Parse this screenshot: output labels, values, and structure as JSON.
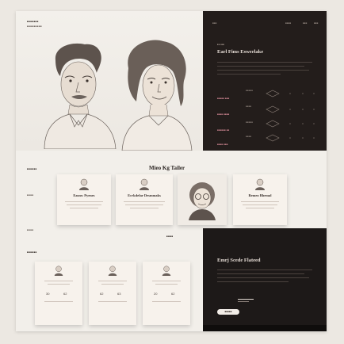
{
  "header": {
    "brand": "■■■■■■■",
    "brand_sub": "■■■■■■■■■"
  },
  "hero": {
    "title": "Earl Fims Eswerlake",
    "nav": [
      "■■■",
      "■■■■",
      "■■■",
      "■■■"
    ],
    "rows": [
      {
        "a": "■■■■■ ■■■",
        "b": "■■■■■",
        "c": "■■■"
      },
      {
        "a": "■■■■ ■■■■",
        "b": "■■■■",
        "c": "■■■"
      },
      {
        "a": "■■■■■■ ■■",
        "b": "■■■■■",
        "c": "■■■"
      },
      {
        "a": "■■■■ ■■■",
        "b": "■■■■",
        "c": "■■■"
      }
    ]
  },
  "section2": {
    "label": "■■■■■■",
    "title": "Mieo Kg Tailer",
    "side_label_1": "■■■■",
    "side_label_2": "■■■■",
    "cards": [
      {
        "name": "Easnw Pyenes"
      },
      {
        "name": "Ecrkdefar Desmmaks"
      },
      {
        "name": ""
      },
      {
        "name": "Remeo Bhemal"
      }
    ],
    "small_caption": "■■■■"
  },
  "section3": {
    "label": "■■■■■■",
    "cards": [
      {
        "a": "30",
        "b": "62"
      },
      {
        "a": "62",
        "b": "63"
      },
      {
        "a": "20",
        "b": "62"
      }
    ]
  },
  "lower": {
    "title": "Emrj Scede Flateed",
    "button": "■■■■■"
  }
}
